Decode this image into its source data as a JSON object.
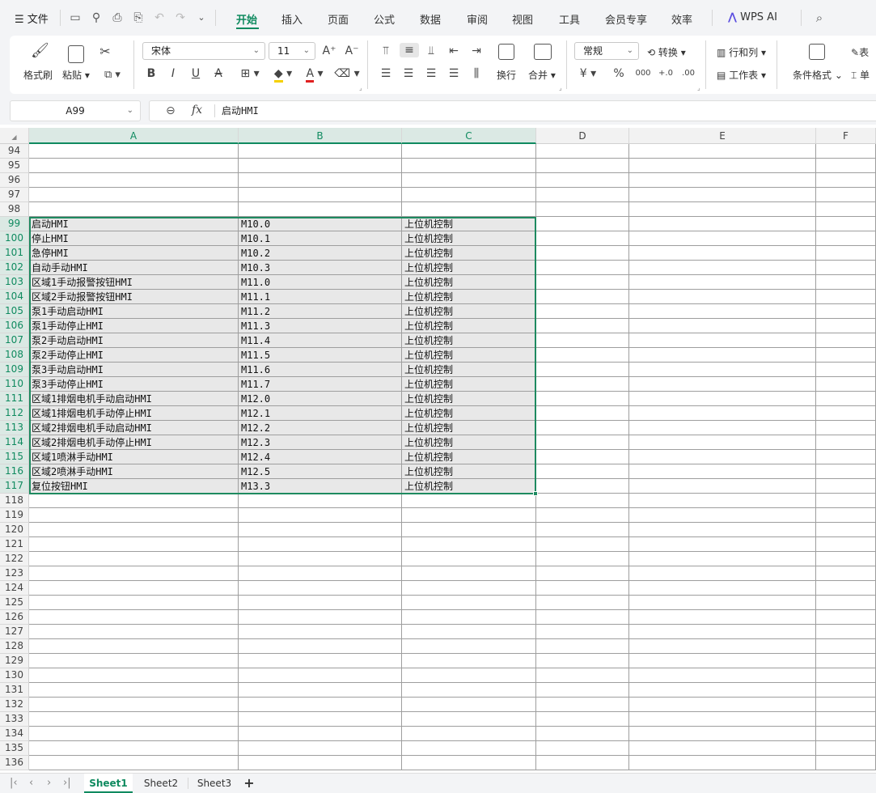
{
  "menu": {
    "file_label": "文件",
    "tabs": [
      "开始",
      "插入",
      "页面",
      "公式",
      "数据",
      "审阅",
      "视图",
      "工具",
      "会员专享",
      "效率"
    ],
    "wps_ai_label": "WPS AI"
  },
  "ribbon": {
    "format_painter": "格式刷",
    "paste": "粘贴",
    "font_name": "宋体",
    "font_size": "11",
    "bold": "B",
    "italic": "I",
    "underline": "U",
    "strike": "A",
    "font_color_glyph": "A",
    "wrap": "换行",
    "merge": "合并",
    "number_format": "常规",
    "convert": "转换",
    "row_col": "行和列",
    "worksheet": "工作表",
    "cond_format": "条件格式",
    "currency": "¥",
    "percent": "%",
    "thousands": "000",
    "dec_inc": "+.0",
    "dec_dec": ".00",
    "table_cut": "表",
    "single_cut": "单"
  },
  "formula_bar": {
    "name_box": "A99",
    "fx_label": "fx",
    "content": "启动HMI"
  },
  "columns": [
    "A",
    "B",
    "C",
    "D",
    "E",
    "F"
  ],
  "row_numbers": [
    "94",
    "95",
    "96",
    "97",
    "98",
    "99",
    "100",
    "101",
    "102",
    "103",
    "104",
    "105",
    "106",
    "107",
    "108",
    "109",
    "110",
    "111",
    "112",
    "113",
    "114",
    "115",
    "116",
    "117",
    "118",
    "119",
    "120",
    "121",
    "122",
    "123",
    "124",
    "125",
    "126",
    "127",
    "128",
    "129",
    "130",
    "131",
    "132",
    "133",
    "134",
    "135",
    "136"
  ],
  "rows": [
    [
      "",
      "",
      ""
    ],
    [
      "",
      "",
      ""
    ],
    [
      "",
      "",
      ""
    ],
    [
      "",
      "",
      ""
    ],
    [
      "",
      "",
      ""
    ],
    [
      "启动HMI",
      "M10.0",
      "上位机控制"
    ],
    [
      "停止HMI",
      "M10.1",
      "上位机控制"
    ],
    [
      "急停HMI",
      "M10.2",
      "上位机控制"
    ],
    [
      "自动手动HMI",
      "M10.3",
      "上位机控制"
    ],
    [
      "区域1手动报警按钮HMI",
      "M11.0",
      "上位机控制"
    ],
    [
      "区域2手动报警按钮HMI",
      "M11.1",
      "上位机控制"
    ],
    [
      "泵1手动启动HMI",
      "M11.2",
      "上位机控制"
    ],
    [
      "泵1手动停止HMI",
      "M11.3",
      "上位机控制"
    ],
    [
      "泵2手动启动HMI",
      "M11.4",
      "上位机控制"
    ],
    [
      "泵2手动停止HMI",
      "M11.5",
      "上位机控制"
    ],
    [
      "泵3手动启动HMI",
      "M11.6",
      "上位机控制"
    ],
    [
      "泵3手动停止HMI",
      "M11.7",
      "上位机控制"
    ],
    [
      "区域1排烟电机手动启动HMI",
      "M12.0",
      "上位机控制"
    ],
    [
      "区域1排烟电机手动停止HMI",
      "M12.1",
      "上位机控制"
    ],
    [
      "区域2排烟电机手动启动HMI",
      "M12.2",
      "上位机控制"
    ],
    [
      "区域2排烟电机手动停止HMI",
      "M12.3",
      "上位机控制"
    ],
    [
      "区域1喷淋手动HMI",
      "M12.4",
      "上位机控制"
    ],
    [
      "区域2喷淋手动HMI",
      "M12.5",
      "上位机控制"
    ],
    [
      "复位按钮HMI",
      "M13.3",
      "上位机控制"
    ]
  ],
  "selection": {
    "first_row": "99",
    "last_row": "117",
    "columns": [
      "A",
      "B",
      "C"
    ]
  },
  "sheets": [
    "Sheet1",
    "Sheet2",
    "Sheet3"
  ],
  "add_sheet": "+",
  "colors": {
    "accent": "#0f8a5f",
    "selection_border": "#1e8a60",
    "selected_fill": "#e8e8e8"
  }
}
